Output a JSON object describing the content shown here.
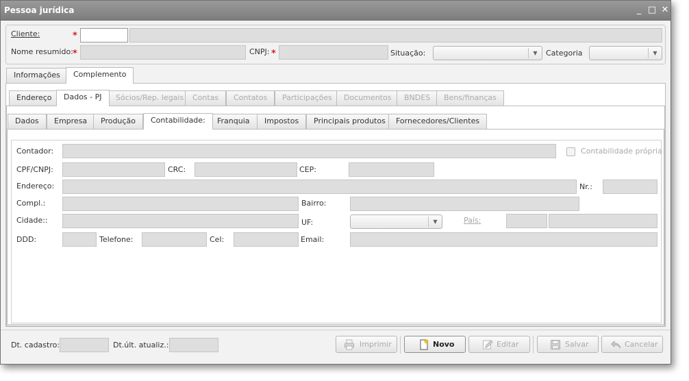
{
  "window": {
    "title": "Pessoa jurídica",
    "controls": {
      "minimize": "_",
      "maximize": "□",
      "close": "✕"
    }
  },
  "header": {
    "cliente_label": "Cliente:",
    "nome_resumido_label": "Nome resumido:",
    "cnpj_label": "CNPJ:",
    "situacao_label": "Situação:",
    "categoria_label": "Categoria",
    "required_mark": "*"
  },
  "main_tabs": [
    {
      "label": "Informações",
      "active": false
    },
    {
      "label": "Complemento",
      "active": true
    }
  ],
  "complemento_tabs": [
    {
      "label": "Endereço",
      "active": false,
      "enabled": true
    },
    {
      "label": "Dados - PJ",
      "active": true,
      "enabled": true
    },
    {
      "label": "Sócios/Rep. legais",
      "active": false,
      "enabled": false
    },
    {
      "label": "Contas",
      "active": false,
      "enabled": false
    },
    {
      "label": "Contatos",
      "active": false,
      "enabled": false
    },
    {
      "label": "Participações",
      "active": false,
      "enabled": false
    },
    {
      "label": "Documentos",
      "active": false,
      "enabled": false
    },
    {
      "label": "BNDES",
      "active": false,
      "enabled": false
    },
    {
      "label": "Bens/finanças",
      "active": false,
      "enabled": false
    }
  ],
  "dados_pj_tabs": [
    {
      "label": "Dados",
      "active": false
    },
    {
      "label": "Empresa",
      "active": false
    },
    {
      "label": "Produção",
      "active": false
    },
    {
      "label": "Contabilidade:",
      "active": true
    },
    {
      "label": "Franquia",
      "active": false
    },
    {
      "label": "Impostos",
      "active": false
    },
    {
      "label": "Principais produtos",
      "active": false
    },
    {
      "label": "Fornecedores/Clientes",
      "active": false
    }
  ],
  "contabilidade": {
    "contador_label": "Contador:",
    "contabilidade_propria_label": "Contabilidade própria",
    "cpf_cnpj_label": "CPF/CNPJ:",
    "crc_label": "CRC:",
    "cep_label": "CEP:",
    "endereco_label": "Endereço:",
    "nr_label": "Nr.:",
    "compl_label": "Compl.:",
    "bairro_label": "Bairro:",
    "cidade_label": "Cidade::",
    "uf_label": "UF:",
    "pais_label": "País:",
    "ddd_label": "DDD:",
    "telefone_label": "Telefone:",
    "cel_label": "Cel:",
    "email_label": "Email:"
  },
  "footer": {
    "dt_cadastro_label": "Dt. cadastro:",
    "dt_ult_atualiz_label": "Dt.últ. atualiz.:",
    "buttons": {
      "imprimir": "Imprimir",
      "novo": "Novo",
      "editar": "Editar",
      "salvar": "Salvar",
      "cancelar": "Cancelar"
    }
  },
  "icons": [
    "printer-icon",
    "new-document-icon",
    "edit-pencil-icon",
    "save-disk-icon",
    "undo-arrow-icon"
  ],
  "colors": {
    "required": "#d92020",
    "titlebar": "#8a8a8a",
    "field_disabled": "#dedede"
  }
}
